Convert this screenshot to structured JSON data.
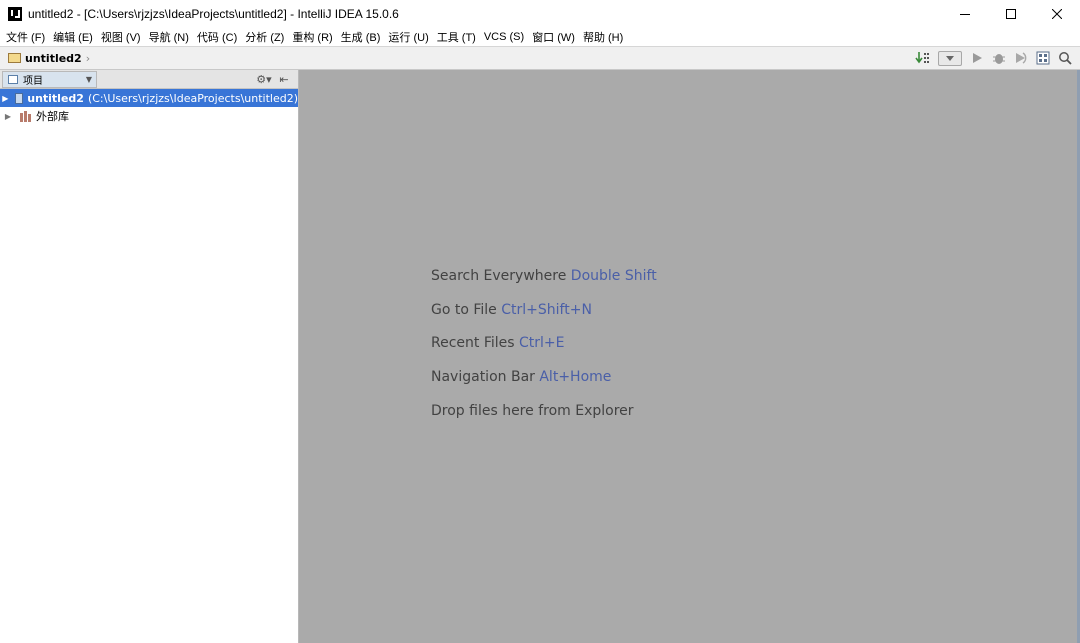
{
  "window": {
    "title": "untitled2 - [C:\\Users\\rjzjzs\\IdeaProjects\\untitled2] - IntelliJ IDEA 15.0.6",
    "app_icon": "intellij-icon",
    "controls": [
      "minimize-icon",
      "maximize-icon",
      "close-icon"
    ]
  },
  "menu": {
    "items": [
      {
        "label": "文件 (F)"
      },
      {
        "label": "编辑 (E)"
      },
      {
        "label": "视图 (V)"
      },
      {
        "label": "导航 (N)"
      },
      {
        "label": "代码 (C)"
      },
      {
        "label": "分析 (Z)"
      },
      {
        "label": "重构 (R)"
      },
      {
        "label": "生成 (B)"
      },
      {
        "label": "运行 (U)"
      },
      {
        "label": "工具 (T)"
      },
      {
        "label": "VCS (S)"
      },
      {
        "label": "窗口 (W)"
      },
      {
        "label": "帮助 (H)"
      }
    ]
  },
  "navbar": {
    "breadcrumb": "untitled2",
    "tools": [
      "make-project-icon",
      "run-config-dropdown",
      "run-icon",
      "debug-icon",
      "coverage-icon",
      "project-structure-icon",
      "search-icon"
    ]
  },
  "project_pane": {
    "view_label": "项目",
    "tree": [
      {
        "name": "untitled2",
        "path": "(C:\\Users\\rjzjzs\\IdeaProjects\\untitled2)",
        "selected": true
      },
      {
        "name": "外部库",
        "path": "",
        "selected": false
      }
    ]
  },
  "editor": {
    "hints": [
      {
        "text": "Search Everywhere",
        "key": "Double Shift"
      },
      {
        "text": "Go to File",
        "key": "Ctrl+Shift+N"
      },
      {
        "text": "Recent Files",
        "key": "Ctrl+E"
      },
      {
        "text": "Navigation Bar",
        "key": "Alt+Home"
      },
      {
        "text": "Drop files here from Explorer",
        "key": ""
      }
    ]
  },
  "colors": {
    "selection": "#3875d7",
    "editor_bg": "#aaaaaa",
    "hint_text": "#424242",
    "hint_key": "#4a5fa8"
  }
}
